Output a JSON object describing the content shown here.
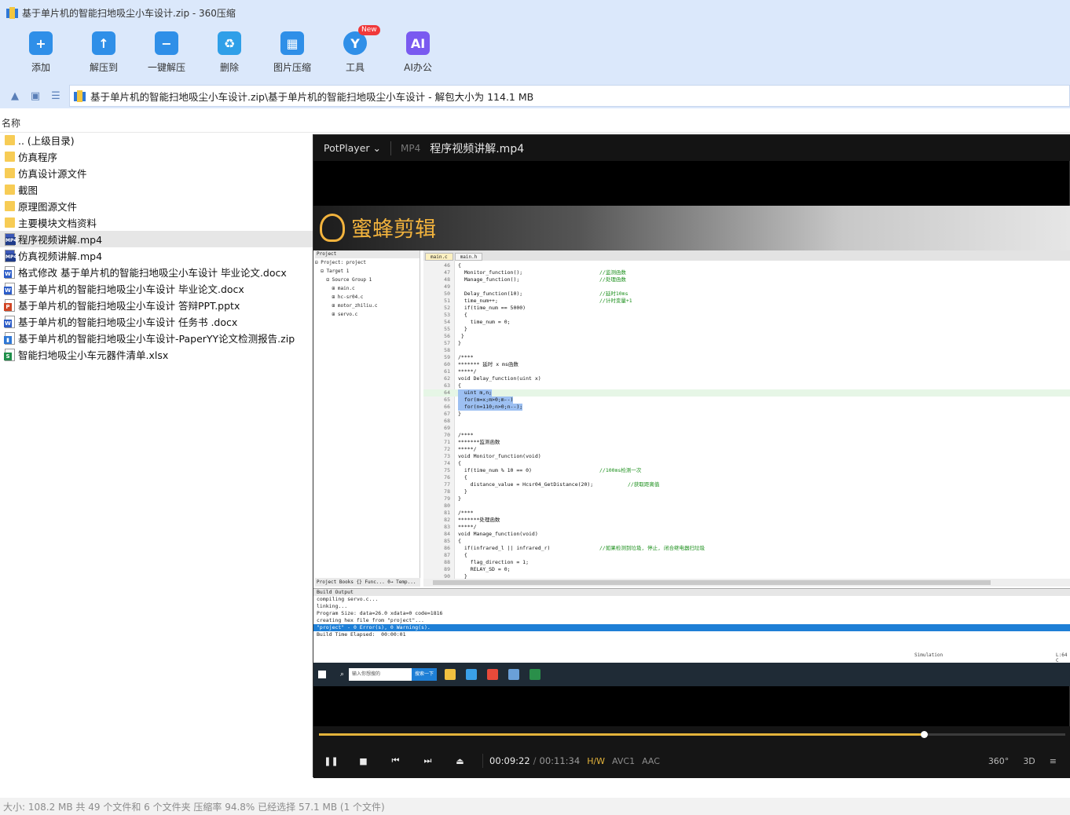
{
  "window": {
    "title": "基于单片机的智能扫地吸尘小车设计.zip - 360压缩"
  },
  "toolbar": {
    "items": [
      {
        "label": "添加",
        "icon": "add-icon",
        "color": "#2f8fe8"
      },
      {
        "label": "解压到",
        "icon": "extract-to-icon",
        "color": "#2f8fe8"
      },
      {
        "label": "一键解压",
        "icon": "one-click-extract-icon",
        "color": "#2f8fe8"
      },
      {
        "label": "删除",
        "icon": "delete-icon",
        "color": "#2f9fe8"
      },
      {
        "label": "图片压缩",
        "icon": "image-compress-icon",
        "color": "#2f8fe8"
      },
      {
        "label": "工具",
        "icon": "tools-icon",
        "color": "#2f8fe8",
        "badge": "New"
      },
      {
        "label": "AI办公",
        "icon": "ai-office-icon",
        "color": "#7a5af0"
      }
    ]
  },
  "address": {
    "path": "基于单片机的智能扫地吸尘小车设计.zip\\基于单片机的智能扫地吸尘小车设计 - 解包大小为 114.1 MB"
  },
  "columns": {
    "name": "名称"
  },
  "files": [
    {
      "name": ".. (上级目录)",
      "type": "folder"
    },
    {
      "name": "仿真程序",
      "type": "folder"
    },
    {
      "name": "仿真设计源文件",
      "type": "folder"
    },
    {
      "name": "截图",
      "type": "folder"
    },
    {
      "name": "原理图源文件",
      "type": "folder"
    },
    {
      "name": "主要模块文档资料",
      "type": "folder"
    },
    {
      "name": "程序视频讲解.mp4",
      "type": "mp4",
      "selected": true
    },
    {
      "name": "仿真视频讲解.mp4",
      "type": "mp4"
    },
    {
      "name": "格式修改 基于单片机的智能扫地吸尘小车设计 毕业论文.docx",
      "type": "docx"
    },
    {
      "name": "基于单片机的智能扫地吸尘小车设计 毕业论文.docx",
      "type": "docx"
    },
    {
      "name": "基于单片机的智能扫地吸尘小车设计 答辩PPT.pptx",
      "type": "pptx"
    },
    {
      "name": "基于单片机的智能扫地吸尘小车设计 任务书 .docx",
      "type": "docx"
    },
    {
      "name": "基于单片机的智能扫地吸尘小车设计-PaperYY论文检测报告.zip",
      "type": "zip"
    },
    {
      "name": "智能扫地吸尘小车元器件清单.xlsx",
      "type": "xlsx"
    }
  ],
  "status": {
    "text": "大小: 108.2 MB 共 49 个文件和 6 个文件夹 压缩率 94.8% 已经选择 57.1 MB (1 个文件)"
  },
  "player": {
    "brand": "PotPlayer ⌄",
    "format": "MP4",
    "filename": "程序视频讲解.mp4",
    "watermark": "蜜蜂剪辑",
    "current_time": "00:09:22",
    "total_time": "00:11:34",
    "progress": 0.81,
    "codec_hw": "H/W",
    "codec_video": "AVC1",
    "codec_audio": "AAC",
    "right_icons": [
      "360°",
      "3D",
      "≡"
    ],
    "accent": "#e3b33b"
  },
  "ide": {
    "project_head": "Project",
    "project_tree": [
      "⊟ Project: project",
      "  ⊟ Target 1",
      "    ⊟ Source Group 1",
      "      ⊞ main.c",
      "      ⊞ hc-sr04.c",
      "      ⊞ motor_zhiliu.c",
      "      ⊞ servo.c"
    ],
    "project_tabs": "Project  Books  {} Func...  0→ Temp...",
    "tabs": [
      "main.c",
      "main.h"
    ],
    "code_lines": [
      {
        "n": "46",
        "t": "{"
      },
      {
        "n": "47",
        "t": "  Monitor_function();",
        "c": "//监测函数"
      },
      {
        "n": "48",
        "t": "  Manage_function();",
        "c": "//处理函数"
      },
      {
        "n": "49",
        "t": ""
      },
      {
        "n": "50",
        "t": "  Delay_function(10);",
        "c": "//延时10ms"
      },
      {
        "n": "51",
        "t": "  time_num++;",
        "c": "//计时变量+1"
      },
      {
        "n": "52",
        "t": "  if(time_num == 5000)"
      },
      {
        "n": "53",
        "t": "  {"
      },
      {
        "n": "54",
        "t": "    time_num = 0;"
      },
      {
        "n": "55",
        "t": "  }"
      },
      {
        "n": "56",
        "t": " }"
      },
      {
        "n": "57",
        "t": "}"
      },
      {
        "n": "58",
        "t": ""
      },
      {
        "n": "59",
        "t": "/****"
      },
      {
        "n": "60",
        "t": "******* 延时 x ms函数"
      },
      {
        "n": "61",
        "t": "*****/"
      },
      {
        "n": "62",
        "t": "void Delay_function(uint x)"
      },
      {
        "n": "63",
        "t": "{"
      },
      {
        "n": "64",
        "t": "  uint m,n;",
        "sel": true
      },
      {
        "n": "65",
        "t": "  for(m=x;m>0;m--)",
        "sel": true
      },
      {
        "n": "66",
        "t": "  for(n=110;n>0;n--);",
        "sel": true
      },
      {
        "n": "67",
        "t": "}"
      },
      {
        "n": "68",
        "t": ""
      },
      {
        "n": "69",
        "t": ""
      },
      {
        "n": "70",
        "t": "/****"
      },
      {
        "n": "71",
        "t": "*******监测函数"
      },
      {
        "n": "72",
        "t": "*****/"
      },
      {
        "n": "73",
        "t": "void Monitor_function(void)"
      },
      {
        "n": "74",
        "t": "{"
      },
      {
        "n": "75",
        "t": "  if(time_num % 10 == 0)",
        "c": "//100ms检测一次"
      },
      {
        "n": "76",
        "t": "  {"
      },
      {
        "n": "77",
        "t": "    distance_value = Hcsr04_GetDistance(20);",
        "c": "//获取距离值"
      },
      {
        "n": "78",
        "t": "  }"
      },
      {
        "n": "79",
        "t": "}"
      },
      {
        "n": "80",
        "t": ""
      },
      {
        "n": "81",
        "t": "/****"
      },
      {
        "n": "82",
        "t": "*******处理函数"
      },
      {
        "n": "83",
        "t": "*****/"
      },
      {
        "n": "84",
        "t": "void Manage_function(void)"
      },
      {
        "n": "85",
        "t": "{"
      },
      {
        "n": "86",
        "t": "  if(infrared_l || infrared_r)",
        "c": "//如果检测到垃圾, 停止, 闭合继电器扫垃圾"
      },
      {
        "n": "87",
        "t": "  {"
      },
      {
        "n": "88",
        "t": "    flag_direction = 1;"
      },
      {
        "n": "89",
        "t": "    RELAY_SD = 0;"
      },
      {
        "n": "90",
        "t": "  }"
      }
    ],
    "build_head": "Build Output",
    "build_lines": [
      {
        "t": "compiling servo.c..."
      },
      {
        "t": "linking..."
      },
      {
        "t": "Program Size: data=26.0 xdata=0 code=1816"
      },
      {
        "t": "creating hex file from \"project\"..."
      },
      {
        "t": "\"project\" - 0 Error(s), 0 Warning(s).",
        "sel": true
      },
      {
        "t": "Build Time Elapsed:  00:00:01"
      }
    ],
    "simulation": "Simulation",
    "cursor_pos": "L:64 C"
  },
  "taskbar": {
    "search_placeholder": "输入你想搜的",
    "search_button": "搜索一下"
  }
}
